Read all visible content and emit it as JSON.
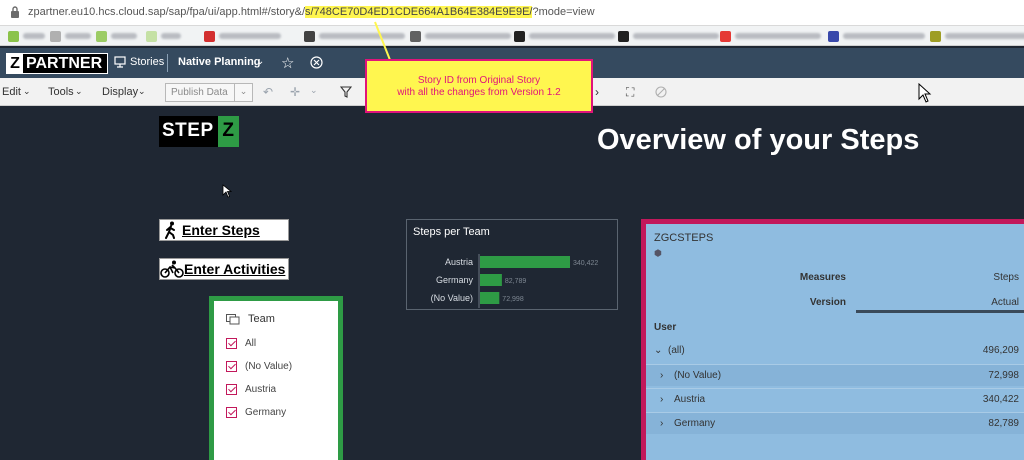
{
  "browser": {
    "url_prefix": "zpartner.eu10.hcs.cloud.sap/sap/fpa/ui/app.html#/story&/",
    "url_highlight": "s/748CE70D4ED1CDE664A1B64E384E9E9E/",
    "url_suffix": "?mode=view"
  },
  "shell": {
    "logo_letter": "Z",
    "logo_text": "PARTNER",
    "stories_label": "Stories",
    "story_name": "Native Planning"
  },
  "toolbar": {
    "edit_label": "Edit",
    "tools_label": "Tools",
    "display_label": "Display",
    "publish_label": "Publish Data"
  },
  "callout": {
    "line1": "Story ID from Original Story",
    "line2": "with all the changes from Version 1.2"
  },
  "canvas": {
    "logo_step": "STEP",
    "logo_z": "Z",
    "title": "Overview of your Steps",
    "enter_steps": "Enter Steps",
    "enter_activities": "Enter Activities"
  },
  "filter": {
    "header": "Team",
    "items": [
      "All",
      "(No Value)",
      "Austria",
      "Germany"
    ]
  },
  "chart_data": {
    "type": "bar",
    "orientation": "horizontal",
    "title": "Steps per Team",
    "categories": [
      "Austria",
      "Germany",
      "(No Value)"
    ],
    "values": [
      340422,
      82789,
      72998
    ],
    "value_labels": [
      "340,422",
      "82,789",
      "72,998"
    ],
    "color": "#2e9b45"
  },
  "table": {
    "title": "ZGCSTEPS",
    "measures_label": "Measures",
    "measures_value": "Steps",
    "version_label": "Version",
    "version_value": "Actual",
    "user_label": "User",
    "rows": [
      {
        "label": "(all)",
        "value": "496,209"
      },
      {
        "label": "(No Value)",
        "value": "72,998"
      },
      {
        "label": "Austria",
        "value": "340,422"
      },
      {
        "label": "Germany",
        "value": "82,789"
      }
    ]
  }
}
